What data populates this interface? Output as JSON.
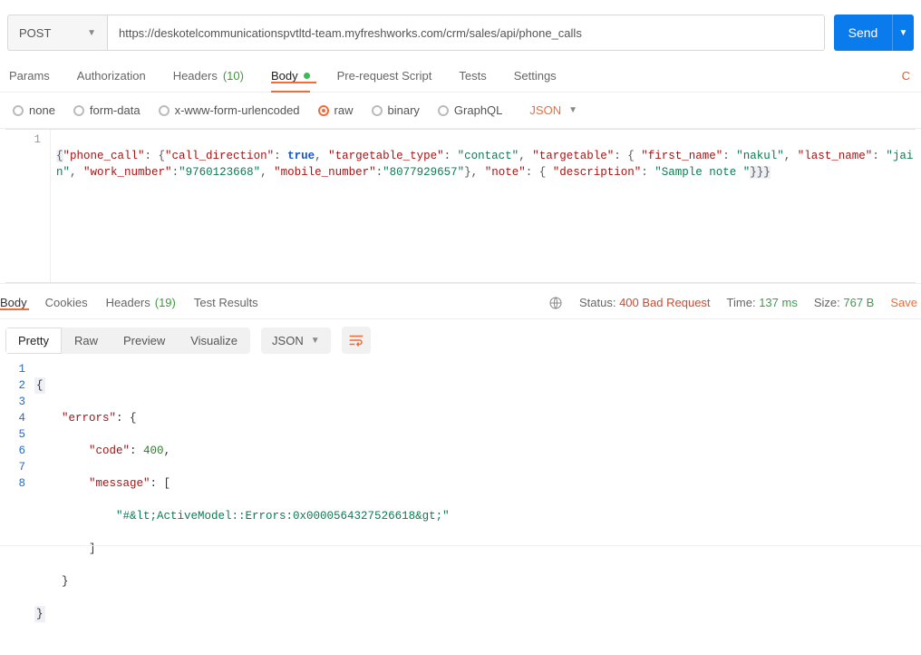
{
  "request": {
    "method": "POST",
    "url": "https://deskotelcommunicationspvtltd-team.myfreshworks.com/crm/sales/api/phone_calls",
    "send_label": "Send"
  },
  "reqTabs": {
    "params": "Params",
    "auth": "Authorization",
    "headers_label": "Headers",
    "headers_count": "(10)",
    "body": "Body",
    "prerequest": "Pre-request Script",
    "tests": "Tests",
    "settings": "Settings",
    "right_cut": "C"
  },
  "bodyTypes": {
    "none": "none",
    "formdata": "form-data",
    "xwww": "x-www-form-urlencoded",
    "raw": "raw",
    "binary": "binary",
    "graphql": "GraphQL",
    "json_label": "JSON"
  },
  "reqBody": {
    "gutter": "1",
    "tokens": {
      "phone_call": "\"phone_call\"",
      "call_direction": "\"call_direction\"",
      "true": "true",
      "targetable_type": "\"targetable_type\"",
      "contact": "\"contact\"",
      "targetable": "\"targetable\"",
      "first_name": "\"first_name\"",
      "nakul": "\"nakul\"",
      "last_name": "\"last_name\"",
      "jain": "\"jain\"",
      "work_number": "\"work_number\"",
      "work_val": "\"9760123668\"",
      "mobile_number": "\"mobile_number\"",
      "mobile_val": "\"8077929657\"",
      "note": "\"note\"",
      "description": "\"description\"",
      "sample": "\"Sample note \""
    }
  },
  "respTabs": {
    "body": "Body",
    "cookies": "Cookies",
    "headers_label": "Headers",
    "headers_count": "(19)",
    "test_results": "Test Results"
  },
  "respMeta": {
    "status_label": "Status:",
    "status_value": "400 Bad Request",
    "time_label": "Time:",
    "time_value": "137 ms",
    "size_label": "Size:",
    "size_value": "767 B",
    "save": "Save"
  },
  "viewRow": {
    "pretty": "Pretty",
    "raw": "Raw",
    "preview": "Preview",
    "visualize": "Visualize",
    "fmt": "JSON"
  },
  "respBody": {
    "gutters": [
      "1",
      "2",
      "3",
      "4",
      "5",
      "6",
      "7",
      "8"
    ],
    "l1": "{",
    "l2_indent": "    ",
    "l2_key": "\"errors\"",
    "l2_rest": ": {",
    "l3_indent": "        ",
    "l3_key": "\"code\"",
    "l3_colon": ": ",
    "l3_val": "400",
    "l3_comma": ",",
    "l4_indent": "        ",
    "l4_key": "\"message\"",
    "l4_rest": ": [",
    "l5_indent": "            ",
    "l5_val": "\"#&lt;ActiveModel::Errors:0x0000564327526618&gt;\"",
    "l6": "        ]",
    "l7": "    }",
    "l8": "}"
  }
}
